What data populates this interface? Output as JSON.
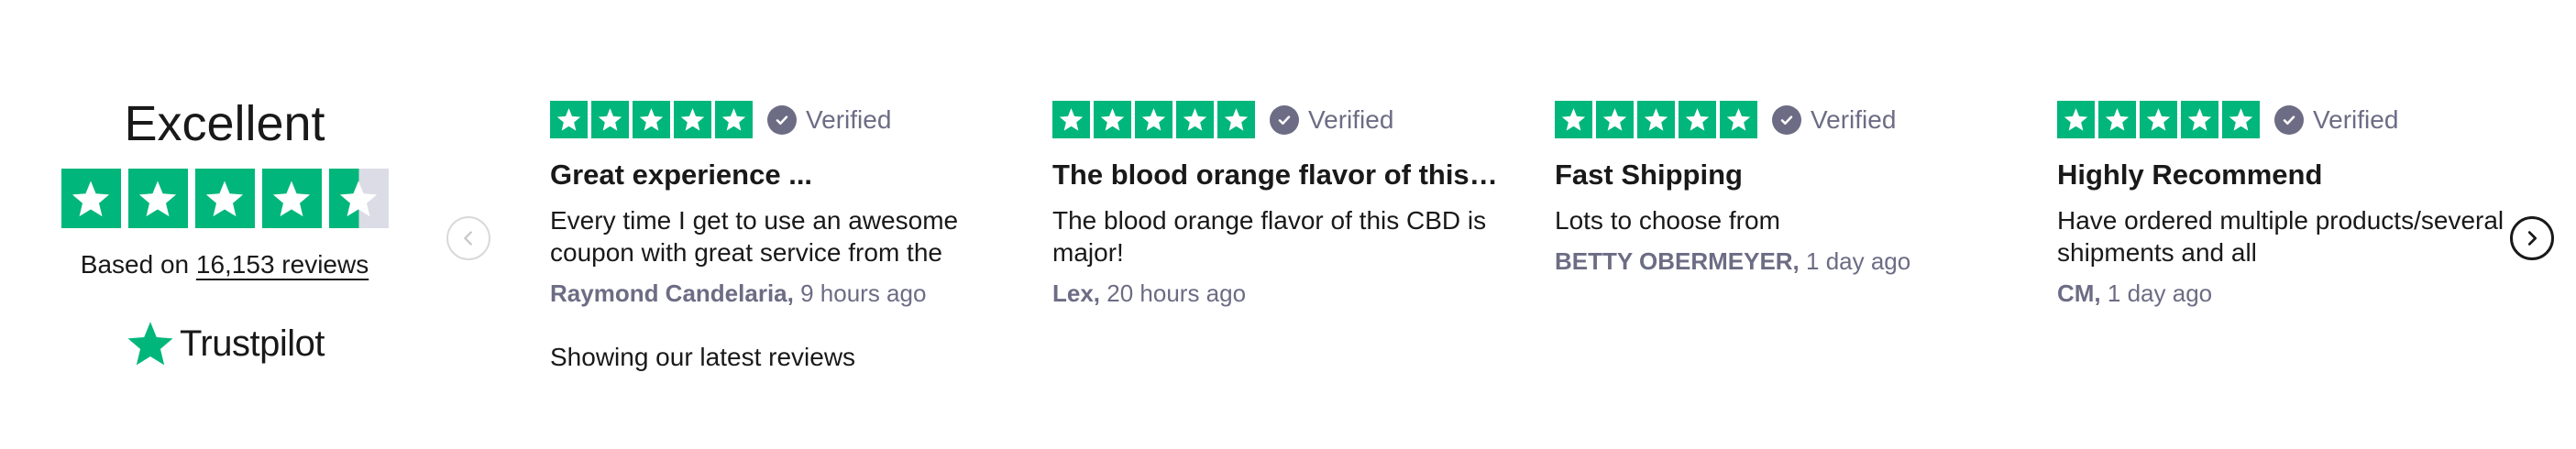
{
  "summary": {
    "title": "Excellent",
    "rating": 4.5,
    "based_on_prefix": "Based on ",
    "reviews_link": "16,153 reviews",
    "brand": "Trustpilot"
  },
  "colors": {
    "star_green": "#00b67a",
    "star_empty": "#dcdce6",
    "verified_gray": "#6c6c85",
    "text": "#191919"
  },
  "icons": {
    "star": "star-icon",
    "verified": "check-circle-icon",
    "prev": "chevron-left-icon",
    "next": "chevron-right-icon",
    "brand": "trustpilot-star-icon"
  },
  "reviews": [
    {
      "stars": 5,
      "verified": "Verified",
      "title": "Great experience ...",
      "body": "Every time I get to use an awesome coupon with great service from the",
      "author": "Raymond Candelaria,",
      "time": "9 hours ago"
    },
    {
      "stars": 5,
      "verified": "Verified",
      "title": "The blood orange flavor of this CBD is major!",
      "body": "The blood orange flavor of this CBD is major!",
      "author": "Lex,",
      "time": "20 hours ago"
    },
    {
      "stars": 5,
      "verified": "Verified",
      "title": "Fast Shipping",
      "body": "Lots to choose from",
      "author": "BETTY OBERMEYER,",
      "time": "1 day ago"
    },
    {
      "stars": 5,
      "verified": "Verified",
      "title": "Highly Recommend",
      "body": "Have ordered multiple products/several shipments and all",
      "author": "CM,",
      "time": "1 day ago"
    }
  ],
  "footer": {
    "latest": "Showing our latest reviews"
  }
}
